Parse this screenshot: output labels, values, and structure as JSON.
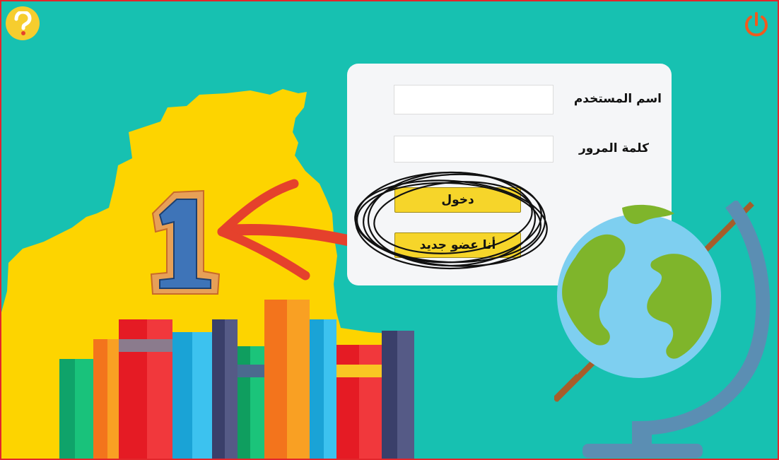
{
  "header": {
    "help_icon": "question-mark-icon",
    "power_icon": "power-icon"
  },
  "login_form": {
    "username_label": "اسم المستخدم",
    "password_label": "كلمة المرور",
    "username_value": "",
    "password_value": "",
    "login_button": "دخول",
    "new_member_button": "أنا عضو جديد"
  },
  "decoration": {
    "number_badge": "1"
  },
  "colors": {
    "background": "#17c1b1",
    "border": "#e2262c",
    "button": "#f6d52a",
    "help_button": "#f6cd2e",
    "power_icon": "#f05a1e",
    "map": "#fdd400",
    "arrow": "#e5412c"
  }
}
